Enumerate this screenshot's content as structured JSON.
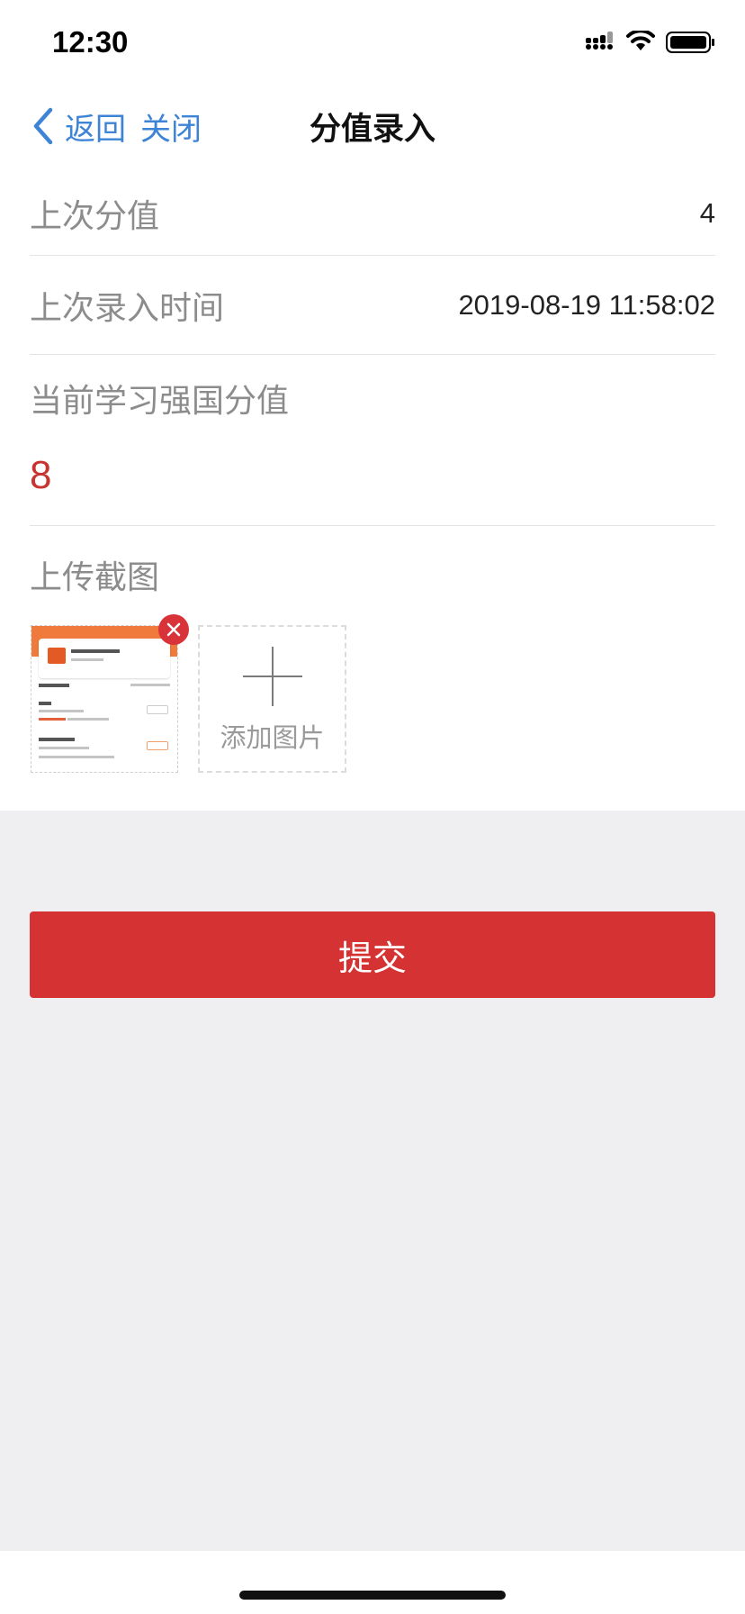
{
  "status_bar": {
    "time": "12:30"
  },
  "nav": {
    "back_label": "返回",
    "close_label": "关闭",
    "title": "分值录入"
  },
  "form": {
    "prev_score_label": "上次分值",
    "prev_score_value": "4",
    "prev_time_label": "上次录入时间",
    "prev_time_value": "2019-08-19 11:58:02",
    "current_score_label": "当前学习强国分值",
    "current_score_value": "8",
    "upload_label": "上传截图",
    "add_image_label": "添加图片"
  },
  "actions": {
    "submit_label": "提交"
  },
  "colors": {
    "accent_blue": "#3d84d6",
    "accent_red": "#d53333",
    "value_red": "#c8342f",
    "background": "#efeff1"
  }
}
